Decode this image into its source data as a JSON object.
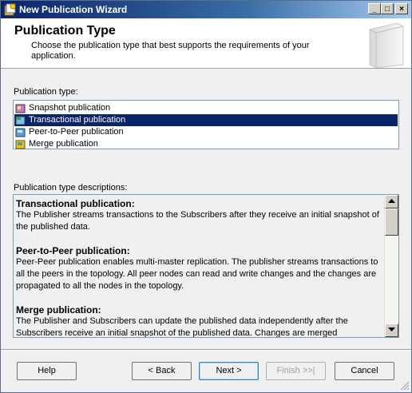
{
  "window": {
    "title": "New Publication Wizard",
    "controls": {
      "minimize": "_",
      "maximize": "□",
      "close": "×"
    }
  },
  "header": {
    "title": "Publication Type",
    "subtitle": "Choose the publication type that best supports the requirements of your application."
  },
  "publication_types": {
    "label": "Publication type:",
    "items": [
      {
        "label": "Snapshot publication",
        "icon": "snapshot-publication-icon",
        "selected": false
      },
      {
        "label": "Transactional publication",
        "icon": "transactional-publication-icon",
        "selected": true
      },
      {
        "label": "Peer-to-Peer publication",
        "icon": "peer-to-peer-publication-icon",
        "selected": false
      },
      {
        "label": "Merge publication",
        "icon": "merge-publication-icon",
        "selected": false
      }
    ]
  },
  "descriptions": {
    "label": "Publication type descriptions:",
    "items": [
      {
        "heading": "Transactional publication:",
        "body": "The Publisher streams transactions to the Subscribers after they receive an initial snapshot of the published data."
      },
      {
        "heading": "Peer-to-Peer publication:",
        "body": "Peer-Peer publication enables multi-master replication. The publisher streams transactions to all the peers in the topology. All peer nodes can read and write changes and the changes are propagated to all the nodes in the topology."
      },
      {
        "heading": "Merge publication:",
        "body": "The Publisher and Subscribers can update the published data independently after the Subscribers receive an initial snapshot of the published data. Changes are merged"
      }
    ]
  },
  "buttons": {
    "help": "Help",
    "back": "< Back",
    "next": "Next >",
    "finish": "Finish >>|",
    "cancel": "Cancel"
  },
  "colors": {
    "selection": "#0a246a",
    "titlebar": "#0a246a"
  }
}
